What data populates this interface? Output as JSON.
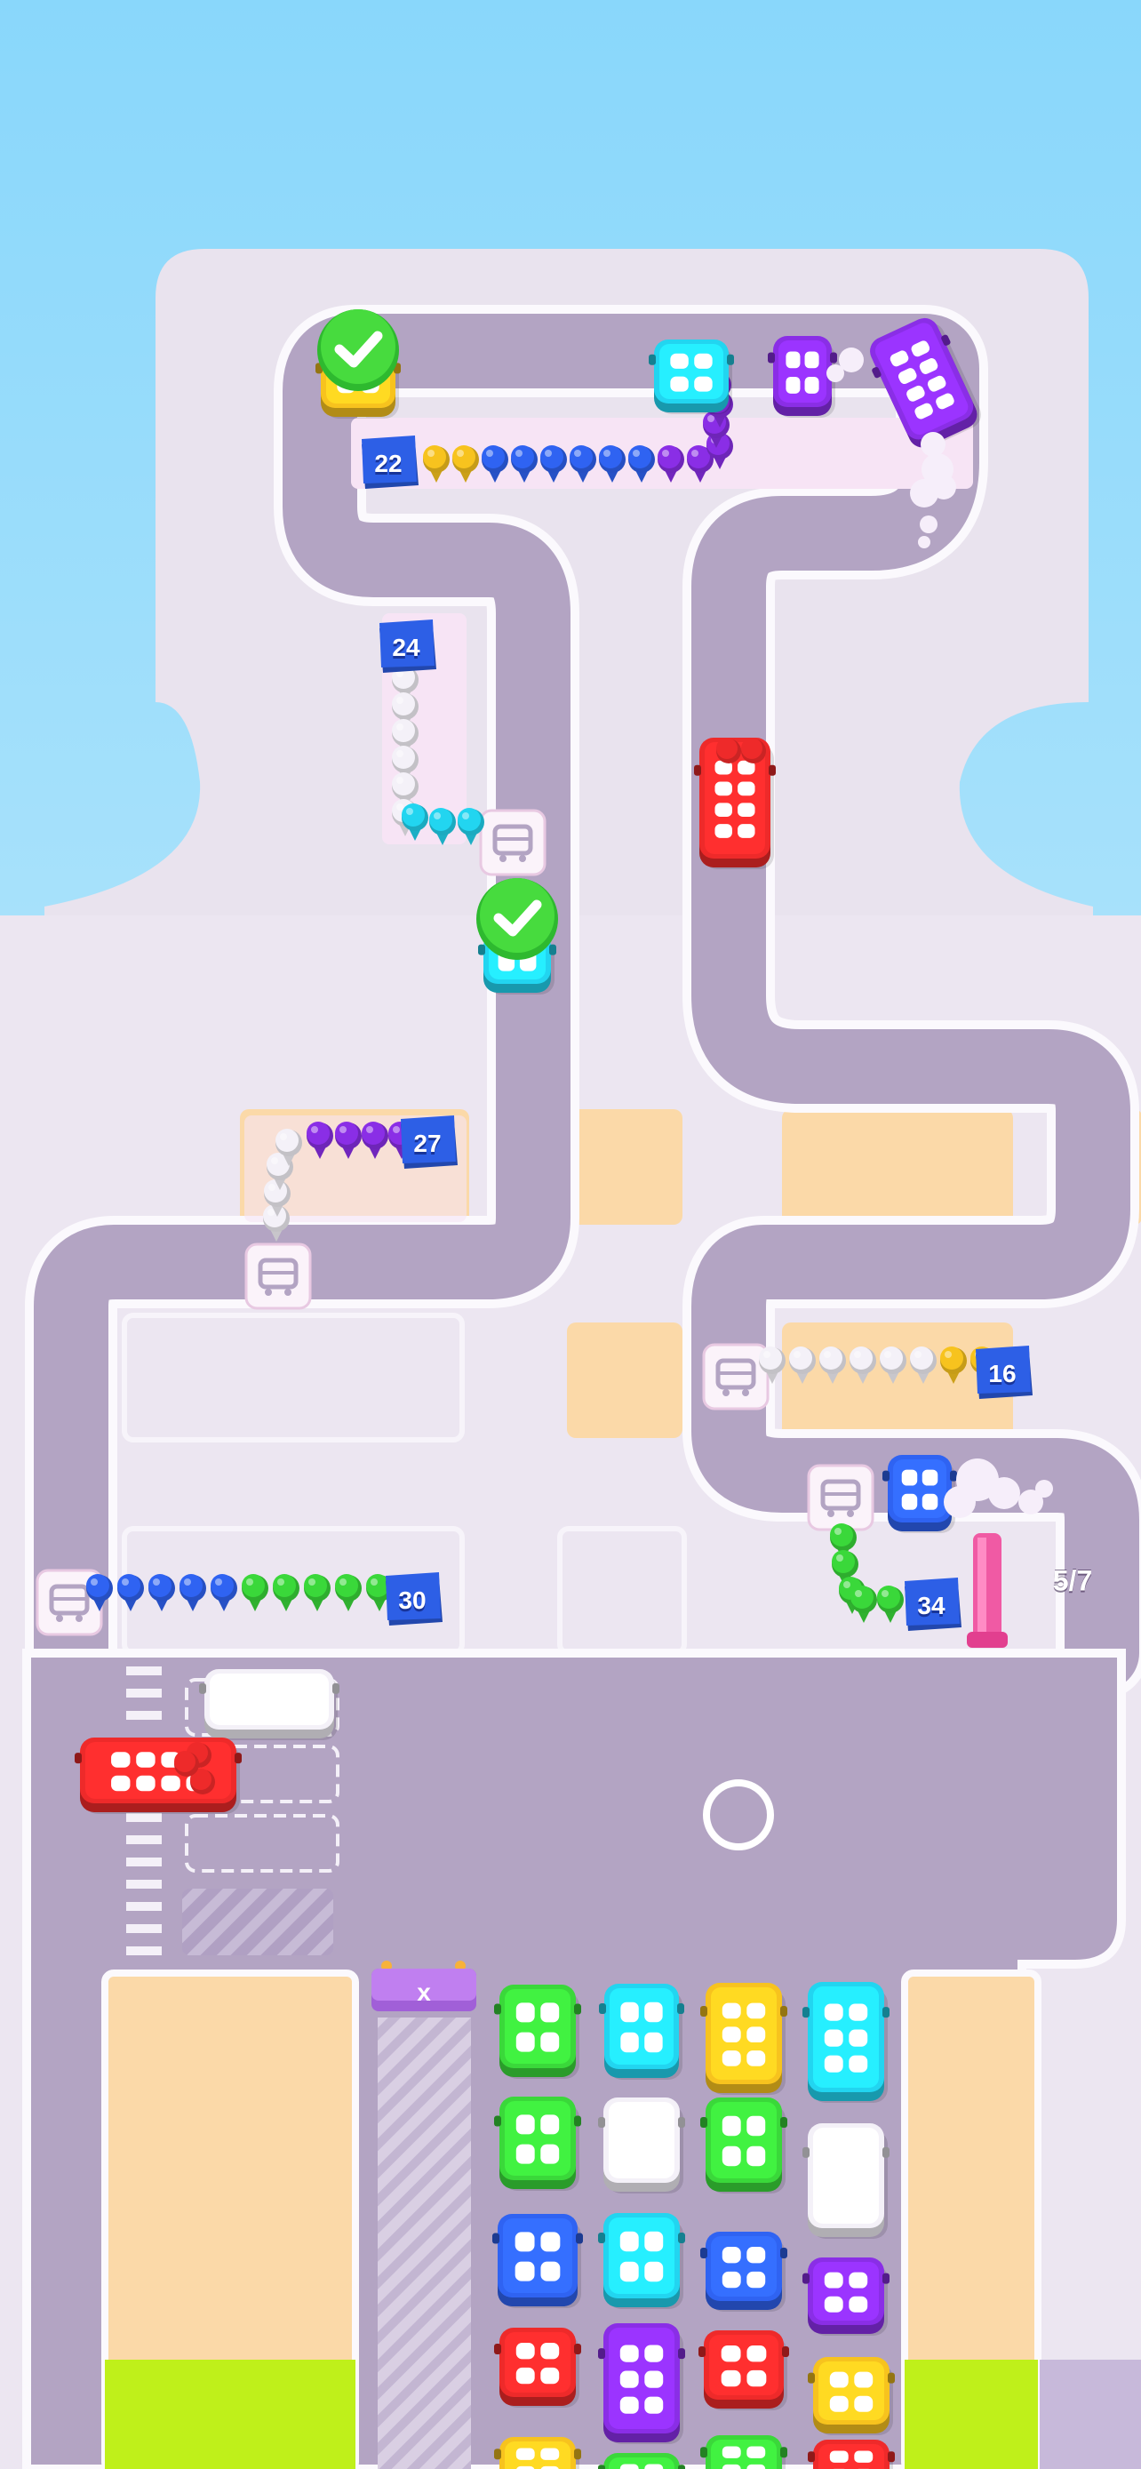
{
  "queues": [
    {
      "id": "q22",
      "count": "22"
    },
    {
      "id": "q24",
      "count": "24"
    },
    {
      "id": "q27",
      "count": "27"
    },
    {
      "id": "q16",
      "count": "16"
    },
    {
      "id": "q30",
      "count": "30"
    },
    {
      "id": "q34",
      "count": "34"
    }
  ],
  "progress": {
    "text": "5/7",
    "done": 5,
    "total": 7
  },
  "garage_exit_symbol": "x",
  "icons": [
    "check-icon",
    "bus-stop-icon",
    "target-ring-icon",
    "puff-cloud-icon"
  ],
  "colors": {
    "sky": "#8fd4f8",
    "road": "#b3a4c3",
    "ground": "#ece6f1",
    "red": "#ee2a2a",
    "blue": "#2f63f2",
    "green": "#3ad83a",
    "cyan": "#22d5f0",
    "yellow": "#f7c31e",
    "purple": "#8a2ee6",
    "white": "#f4f1f8",
    "badge": "#2d5fe6",
    "check": "#39d33a"
  }
}
